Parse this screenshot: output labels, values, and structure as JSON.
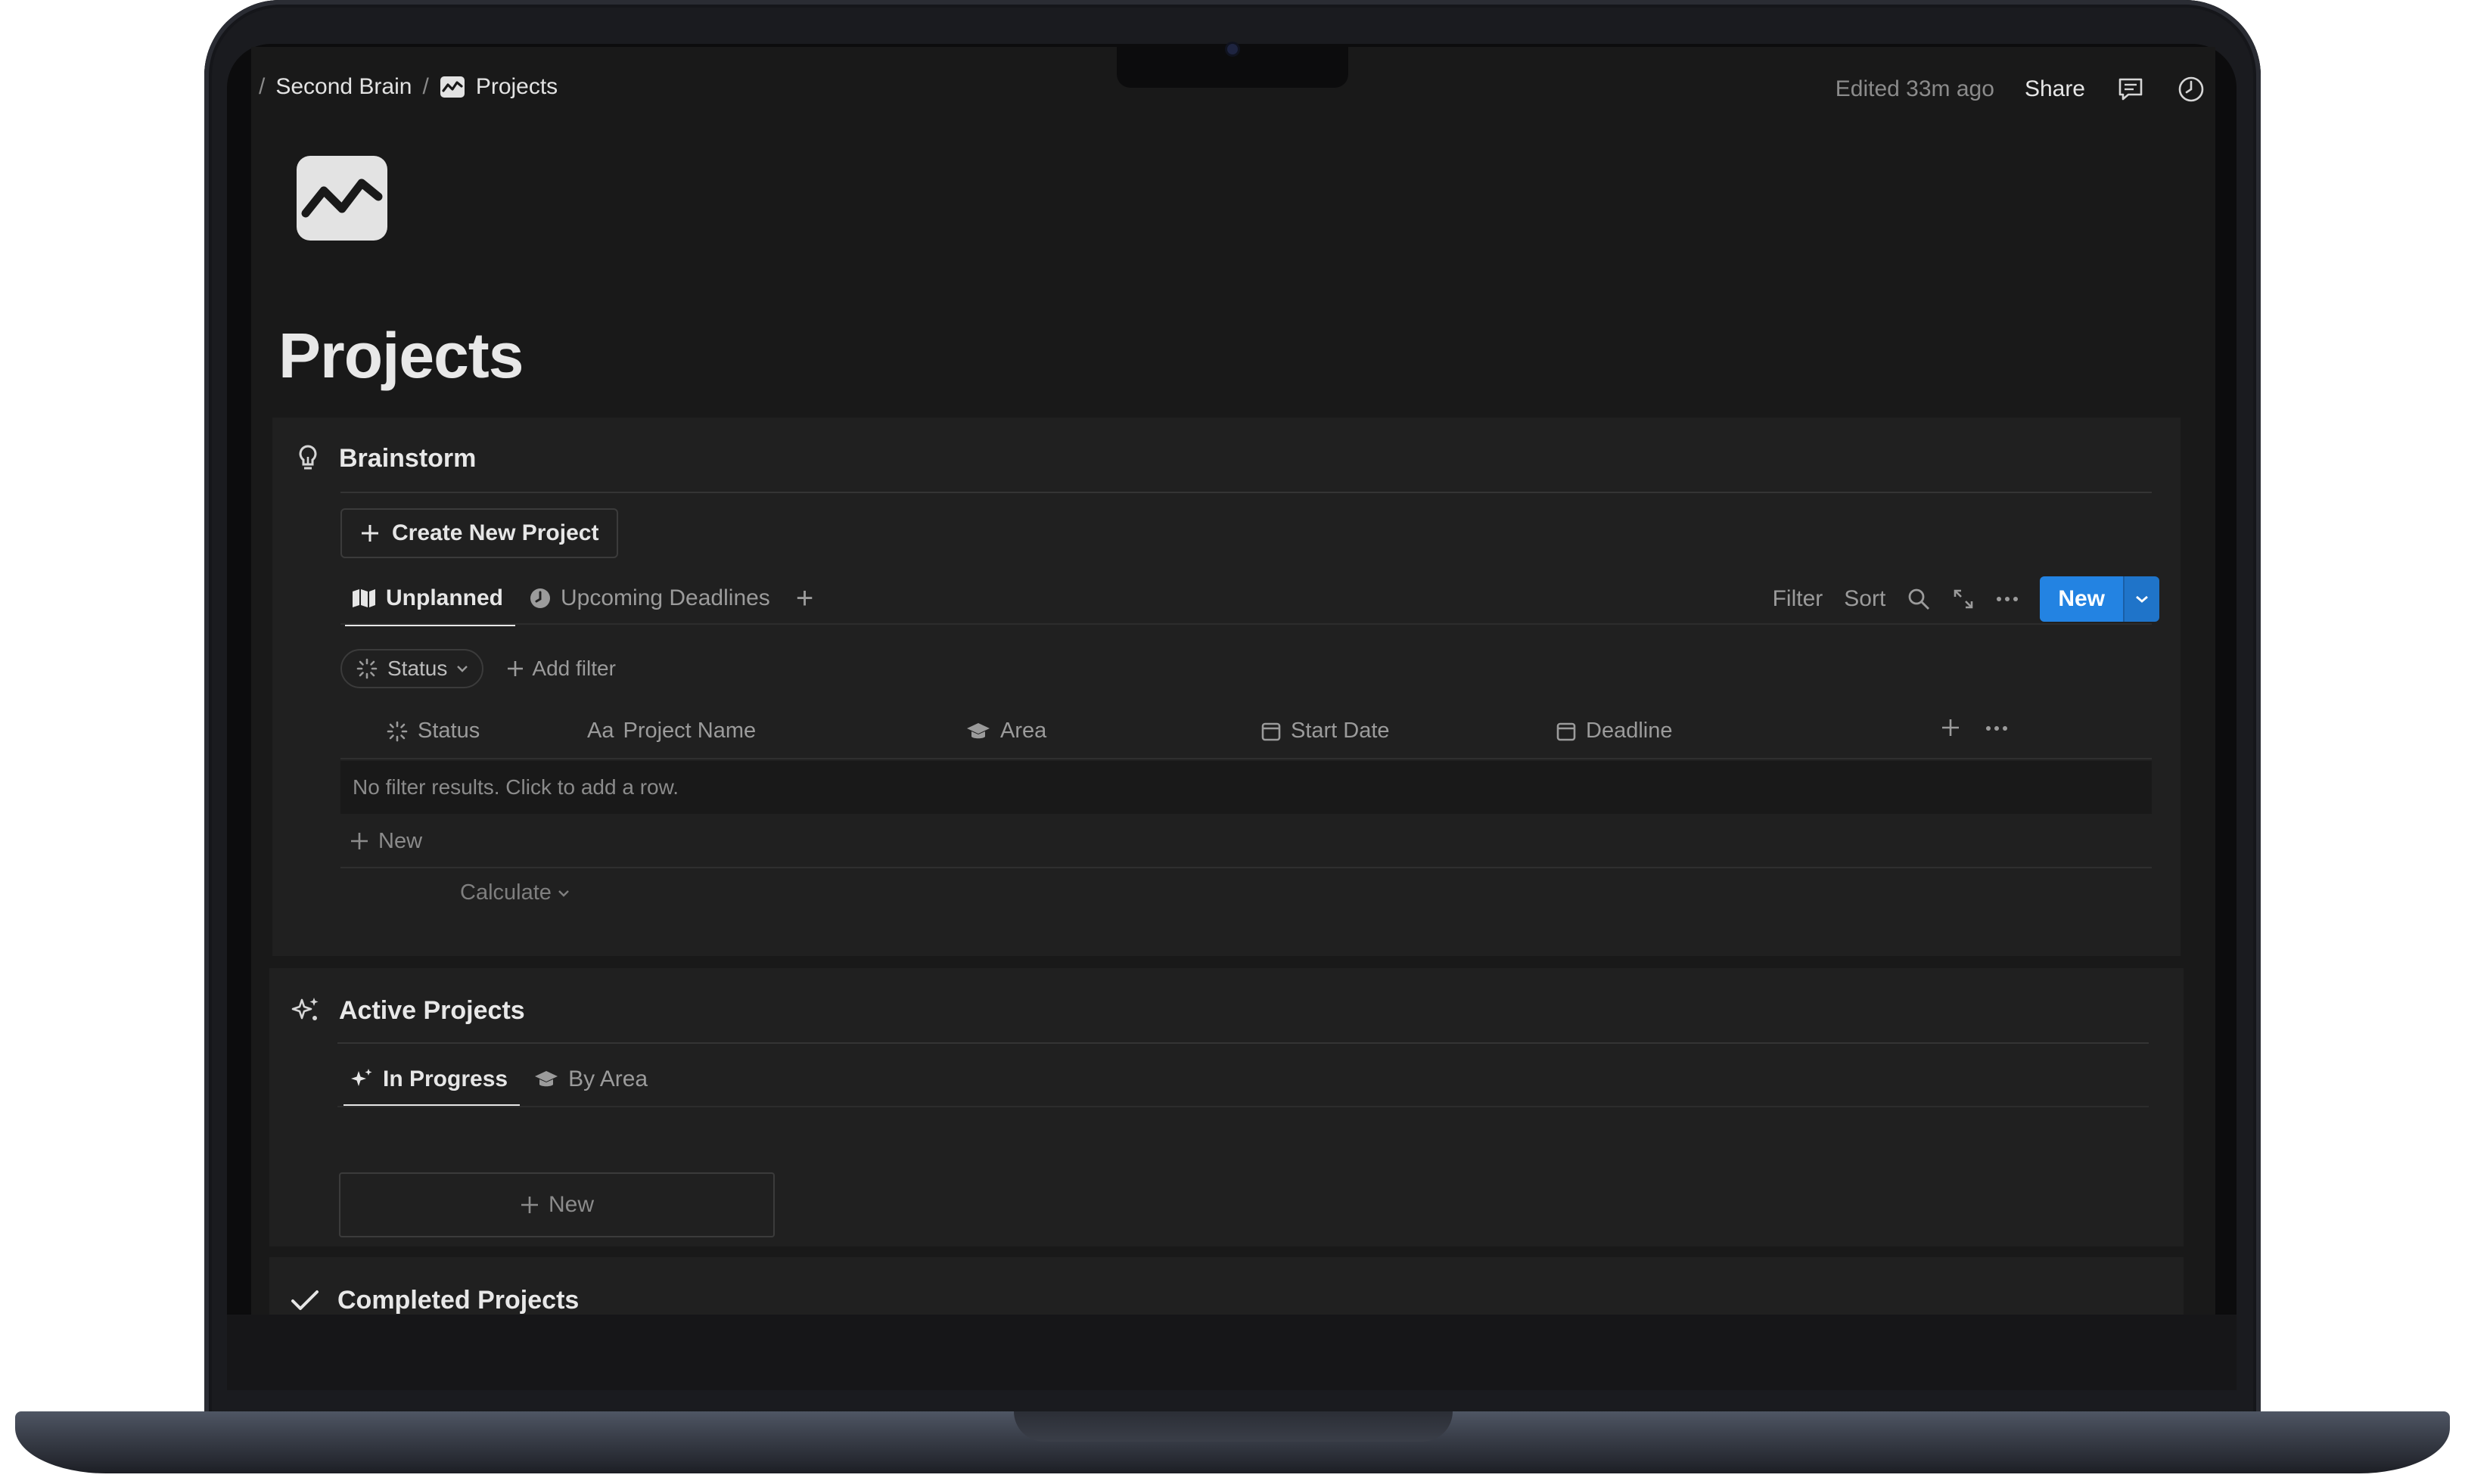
{
  "breadcrumb": {
    "parent": "Second Brain",
    "separator": "/",
    "current": "Projects"
  },
  "topbar": {
    "edited": "Edited 33m ago",
    "share": "Share"
  },
  "page": {
    "title": "Projects"
  },
  "brainstorm": {
    "title": "Brainstorm",
    "create_button": "Create New Project",
    "tabs": [
      {
        "label": "Unplanned",
        "active": true
      },
      {
        "label": "Upcoming Deadlines",
        "active": false
      }
    ],
    "toolbar": {
      "filter": "Filter",
      "sort": "Sort",
      "new": "New"
    },
    "filter_pill": "Status",
    "add_filter": "Add filter",
    "columns": [
      "Status",
      "Project Name",
      "Area",
      "Start Date",
      "Deadline"
    ],
    "empty_message": "No filter results. Click to add a row.",
    "new_row": "New",
    "calculate": "Calculate"
  },
  "active": {
    "title": "Active Projects",
    "tabs": [
      {
        "label": "In Progress",
        "active": true
      },
      {
        "label": "By Area",
        "active": false
      }
    ],
    "new_card": "New"
  },
  "completed": {
    "title": "Completed Projects"
  },
  "colors": {
    "accent": "#2383e2",
    "background": "#191919",
    "card": "#202020",
    "text": "#e6e6e6",
    "muted": "#9b9b9b"
  }
}
